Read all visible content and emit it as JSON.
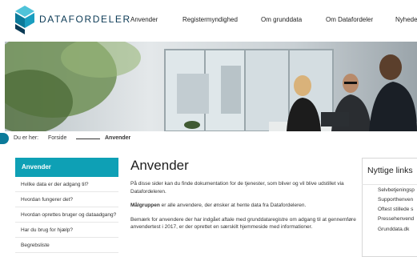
{
  "brand": {
    "name": "DATAFORDELER",
    "colors": {
      "primary": "#0b7a9a",
      "accent": "#0ea0b5",
      "dark": "#0b3a55"
    }
  },
  "nav": {
    "items": [
      "Anvender",
      "Registermyndighed",
      "Om grunddata",
      "Om Datafordeler",
      "Nyhede"
    ]
  },
  "breadcrumb": {
    "prefix": "Du er her:",
    "home": "Forside",
    "current": "Anvender"
  },
  "sidebar": {
    "title": "Anvender",
    "items": [
      "Hvilke data er der adgang til?",
      "Hvordan fungerer det?",
      "Hvordan oprettes bruger og dataadgang?",
      "Har du brug for hjælp?",
      "Begrebsliste"
    ]
  },
  "main": {
    "title": "Anvender",
    "intro": "På disse sider kan du finde dokumentation for de tjenester, som bliver og vil blive udstillet via Datafordeleren.",
    "target_label": "Målgruppen",
    "target_text": " er alle anvendere, der ønsker at hente data fra Datafordeleren.",
    "note": "Bemærk for anvendere der har indgået aftale med grunddataregistre om adgang til at gennemføre anvendertest i 2017, er der oprettet en særskilt hjemmeside med informationer."
  },
  "useful_links": {
    "title": "Nyttige links",
    "items": [
      "Selvbetjeningsp",
      "Supporthenven",
      "Oftest stillede s",
      "Pressehenvend",
      "Grunddata.dk"
    ]
  }
}
